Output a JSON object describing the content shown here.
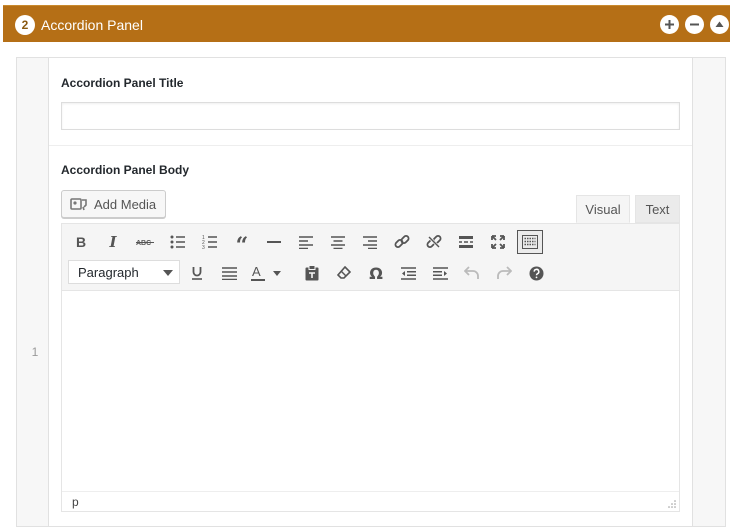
{
  "panel": {
    "number": "2",
    "title": "Accordion Panel",
    "controls": [
      "add-icon",
      "remove-icon",
      "move-up-icon"
    ]
  },
  "row_number": "1",
  "fields": {
    "title_label": "Accordion Panel Title",
    "title_value": "",
    "body_label": "Accordion Panel Body"
  },
  "editor": {
    "add_media_label": "Add Media",
    "tabs": {
      "visual": "Visual",
      "text": "Text"
    },
    "format_select": "Paragraph",
    "status_path": "p"
  },
  "colors": {
    "header_bg": "#b56f16",
    "header_text": "#ffffff"
  }
}
